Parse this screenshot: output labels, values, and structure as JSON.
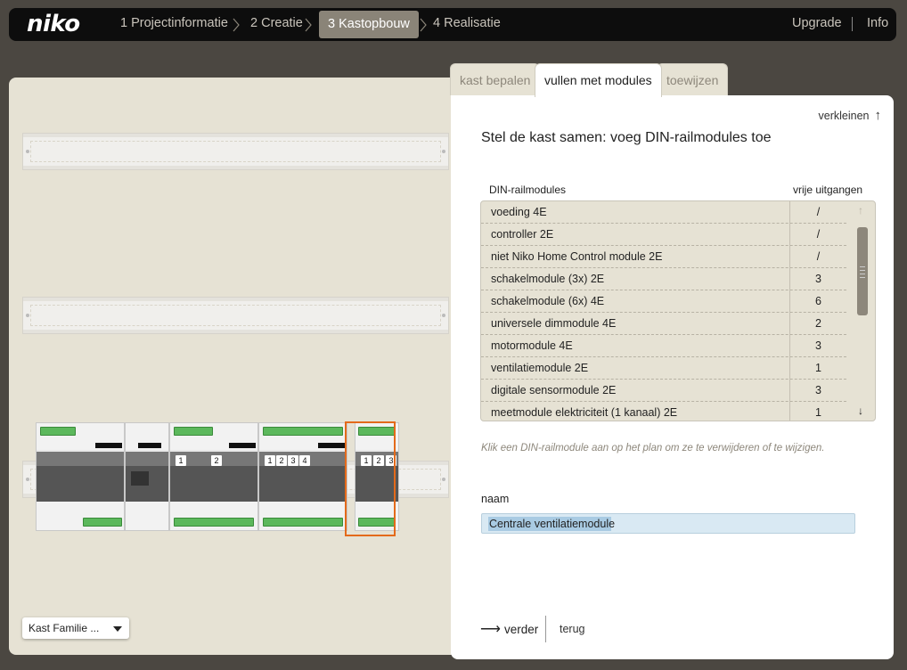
{
  "brand": {
    "logo": "niko"
  },
  "steps": [
    {
      "label": "1 Projectinformatie",
      "active": false
    },
    {
      "label": "2 Creatie",
      "active": false
    },
    {
      "label": "3 Kastopbouw",
      "active": true
    },
    {
      "label": "4 Realisatie",
      "active": false
    }
  ],
  "top_links": {
    "upgrade": "Upgrade",
    "info": "Info"
  },
  "tabs": [
    {
      "label": "kast bepalen",
      "active": false
    },
    {
      "label": "vullen met modules",
      "active": true
    },
    {
      "label": "toewijzen",
      "active": false
    }
  ],
  "panel": {
    "collapse_label": "verkleinen",
    "heading": "Stel de kast samen: voeg DIN-railmodules toe",
    "columns": {
      "name": "DIN-railmodules",
      "free": "vrije uitgangen"
    },
    "modules": [
      {
        "name": "voeding 4E",
        "free": "/"
      },
      {
        "name": "controller 2E",
        "free": "/"
      },
      {
        "name": "niet Niko Home Control module 2E",
        "free": "/"
      },
      {
        "name": "schakelmodule (3x) 2E",
        "free": "3"
      },
      {
        "name": "schakelmodule (6x) 4E",
        "free": "6"
      },
      {
        "name": "universele dimmodule 4E",
        "free": "2"
      },
      {
        "name": "motormodule 4E",
        "free": "3"
      },
      {
        "name": "ventilatiemodule 2E",
        "free": "1"
      },
      {
        "name": "digitale sensormodule 2E",
        "free": "3"
      },
      {
        "name": "meetmodule elektriciteit (1 kanaal) 2E",
        "free": "1"
      }
    ],
    "hint": "Klik een DIN-railmodule aan op het plan om ze te verwijderen of te wijzigen.",
    "name_label": "naam",
    "name_value": "Centrale ventilatiemodule",
    "next_label": "verder",
    "back_label": "terug"
  },
  "cabinet": {
    "family_select": "Kast Familie ...",
    "placed_modules": [
      {
        "name": "voeding",
        "numbers": []
      },
      {
        "name": "controller",
        "numbers": []
      },
      {
        "name": "dimmodule",
        "numbers": [
          "1",
          "2"
        ]
      },
      {
        "name": "motormodule",
        "numbers": [
          "1",
          "2",
          "3",
          "4"
        ]
      },
      {
        "name": "ventilatiemodule",
        "numbers": [
          "1",
          "2",
          "3"
        ],
        "selected": true
      }
    ]
  },
  "colors": {
    "accent_selection": "#e36a1b",
    "topbar": "#0d0d0d",
    "panel_beige": "#e6e2d4",
    "terminal_green": "#5cb85c"
  }
}
